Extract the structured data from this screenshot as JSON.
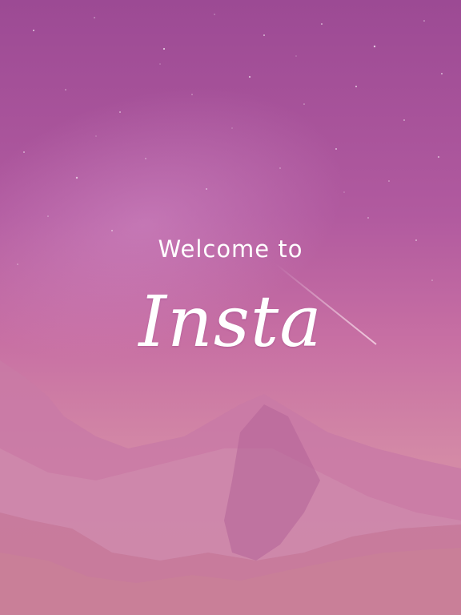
{
  "splash": {
    "welcome_text": "Welcome to",
    "app_name": "Insta"
  },
  "theme": {
    "overlay_top": "#9c4a94",
    "overlay_bottom": "#d99aa3",
    "text_color": "#ffffff"
  },
  "decorations": {
    "background_image": "starry-sky-mountains",
    "shooting_star_icon": "shooting-star-icon"
  }
}
